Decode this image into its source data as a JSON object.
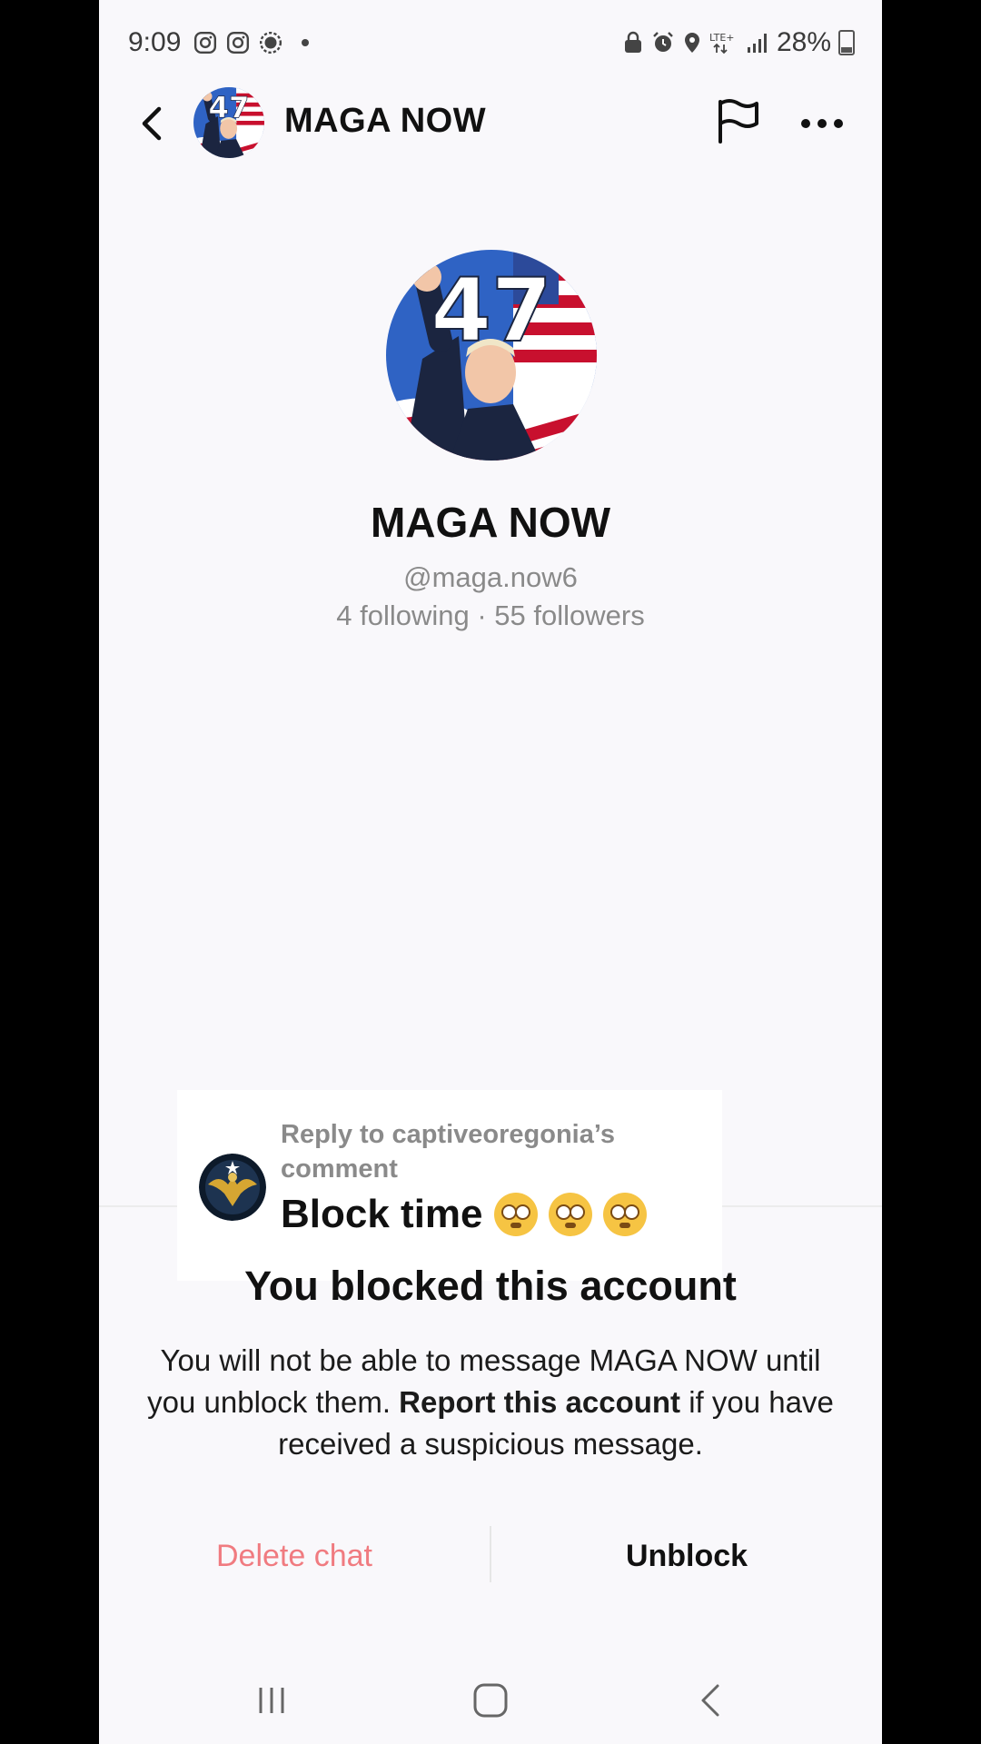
{
  "status_bar": {
    "time": "9:09",
    "battery": "28%",
    "icons": [
      "instagram-icon",
      "instagram-icon",
      "messenger-icon",
      "dot-icon",
      "vpn-icon",
      "alarm-icon",
      "location-icon",
      "lte-icon",
      "signal-icon",
      "battery-icon"
    ]
  },
  "header": {
    "title": "MAGA NOW",
    "avatar_badge": "47"
  },
  "profile": {
    "name": "MAGA NOW",
    "handle": "@maga.now6",
    "stats": "4 following · 55 followers",
    "avatar_badge": "47"
  },
  "reply_overlay": {
    "label": "Reply to captiveoregonia’s comment",
    "text": "Block time",
    "emoji_count": 3
  },
  "blocked": {
    "title": "You blocked this account",
    "message_part1": "You will not be able to message MAGA NOW until you unblock them. ",
    "report_link": "Report this account",
    "message_part2": " if you have received a suspicious message."
  },
  "actions": {
    "delete_label": "Delete chat",
    "unblock_label": "Unblock"
  },
  "colors": {
    "delete": "#f07b80",
    "background": "#f9f8fb",
    "text": "#111111",
    "muted": "#8a8a8a"
  }
}
